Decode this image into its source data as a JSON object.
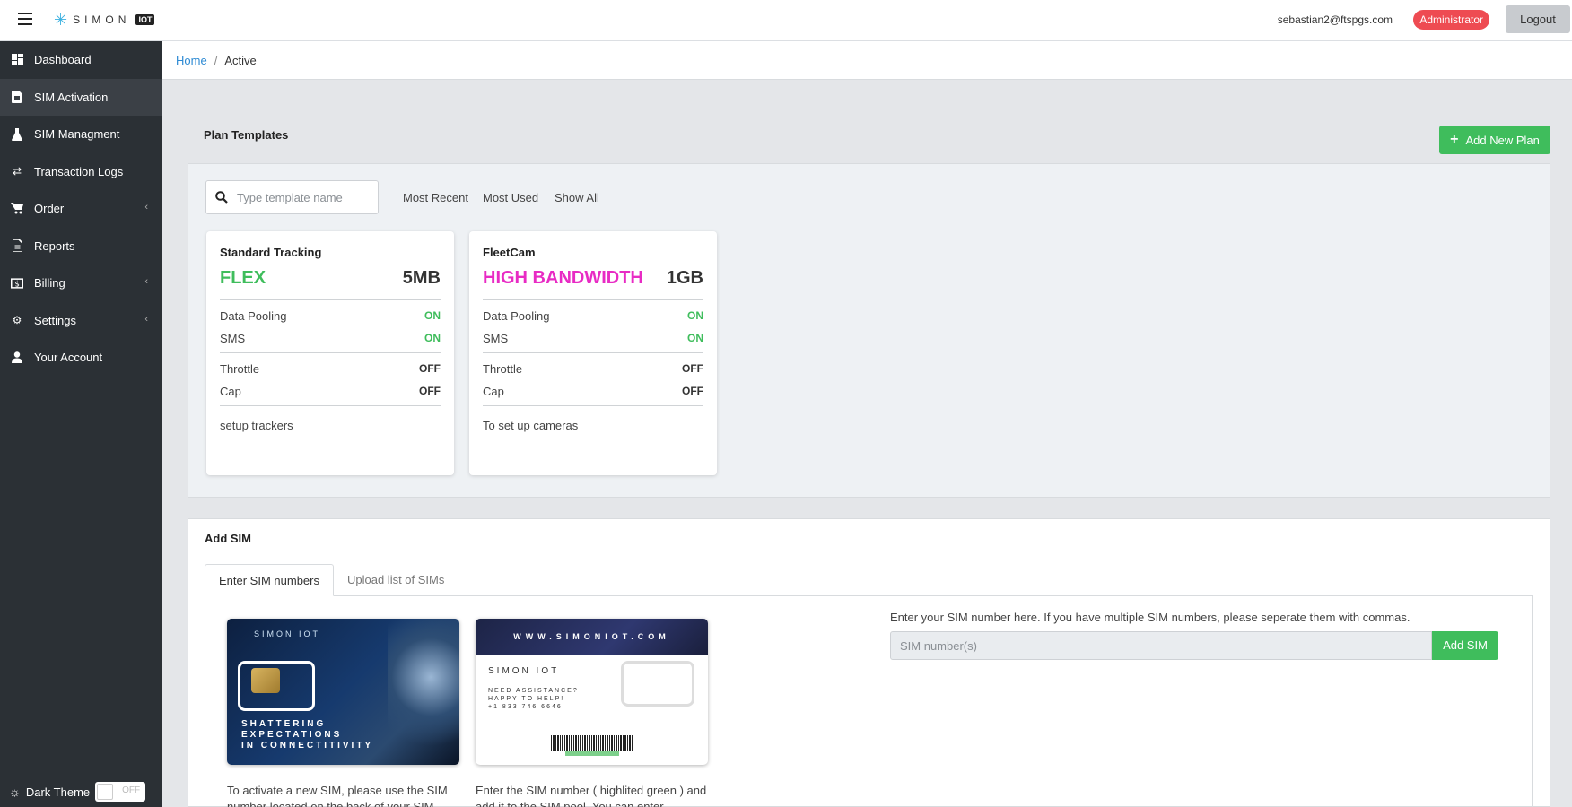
{
  "header": {
    "brand_text": "SIMON",
    "brand_badge": "IOT",
    "user_email": "sebastian2@ftspgs.com",
    "role": "Administrator",
    "logout_label": "Logout"
  },
  "sidebar": {
    "items": [
      {
        "label": "Dashboard",
        "icon": "dashboard-icon",
        "active": false,
        "has_caret": false
      },
      {
        "label": "SIM Activation",
        "icon": "sim-icon",
        "active": true,
        "has_caret": false
      },
      {
        "label": "SIM Managment",
        "icon": "flask-icon",
        "active": false,
        "has_caret": false
      },
      {
        "label": "Transaction Logs",
        "icon": "exchange-icon",
        "active": false,
        "has_caret": false
      },
      {
        "label": "Order",
        "icon": "cart-icon",
        "active": false,
        "has_caret": true
      },
      {
        "label": "Reports",
        "icon": "file-icon",
        "active": false,
        "has_caret": false
      },
      {
        "label": "Billing",
        "icon": "money-icon",
        "active": false,
        "has_caret": true
      },
      {
        "label": "Settings",
        "icon": "gear-icon",
        "active": false,
        "has_caret": true
      },
      {
        "label": "Your Account",
        "icon": "user-icon",
        "active": false,
        "has_caret": false
      }
    ],
    "dark_theme_label": "Dark Theme",
    "dark_theme_state": "OFF"
  },
  "breadcrumb": {
    "home": "Home",
    "separator": "/",
    "current": "Active"
  },
  "plan_templates": {
    "title": "Plan Templates",
    "add_button": "Add New Plan",
    "search_placeholder": "Type template name",
    "filters": [
      "Most Recent",
      "Most Used",
      "Show All"
    ],
    "cards": [
      {
        "name": "Standard Tracking",
        "type": "FLEX",
        "type_color": "#3fbd5c",
        "size": "5MB",
        "features": [
          {
            "label": "Data Pooling",
            "value": "ON"
          },
          {
            "label": "SMS",
            "value": "ON"
          },
          {
            "label": "Throttle",
            "value": "OFF"
          },
          {
            "label": "Cap",
            "value": "OFF"
          }
        ],
        "description": "setup trackers"
      },
      {
        "name": "FleetCam",
        "type": "HIGH BANDWIDTH",
        "type_color": "#e82bc4",
        "size": "1GB",
        "features": [
          {
            "label": "Data Pooling",
            "value": "ON"
          },
          {
            "label": "SMS",
            "value": "ON"
          },
          {
            "label": "Throttle",
            "value": "OFF"
          },
          {
            "label": "Cap",
            "value": "OFF"
          }
        ],
        "description": "To set up cameras"
      }
    ]
  },
  "add_sim": {
    "title": "Add SIM",
    "tabs": [
      "Enter SIM numbers",
      "Upload list of SIMs"
    ],
    "active_tab": "Enter SIM numbers",
    "sim_front": {
      "logo": "SIMON IOT",
      "tagline_lines": [
        "SHATTERING",
        "EXPECTATIONS",
        "IN CONNECTITIVITY"
      ]
    },
    "sim_back": {
      "url": "WWW.SIMONIOT.COM",
      "logo": "SIMON IOT",
      "assist_lines": [
        "NEED ASSISTANCE?",
        "HAPPY TO HELP!",
        "+1 833 746 6646"
      ]
    },
    "caption_front": "To activate a new SIM, please use the SIM number located on the back of your SIM",
    "caption_back": "Enter the SIM number ( highlited green ) and add it to the SIM pool. You can enter",
    "input_label": "Enter your SIM number here. If you have multiple SIM numbers, please seperate them with commas.",
    "input_placeholder": "SIM number(s)",
    "button_label": "Add SIM"
  },
  "colors": {
    "sidebar_bg": "#2b3035",
    "accent_green": "#3fbd5c",
    "role_red": "#ee4b52",
    "link_blue": "#2d8ad3",
    "high_bandwidth_pink": "#e82bc4"
  }
}
